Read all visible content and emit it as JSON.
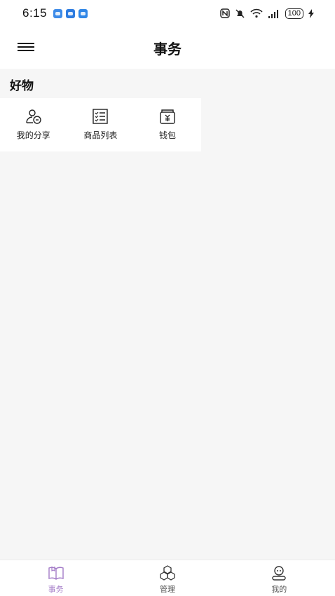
{
  "status_bar": {
    "time": "6:15",
    "battery": "100",
    "app_badge_colors": [
      "#3d8be8",
      "#2c7be0",
      "#2f86e6"
    ]
  },
  "header": {
    "title": "事务",
    "menu_icon": "hamburger-menu-icon"
  },
  "section": {
    "title": "好物",
    "items": [
      {
        "label": "我的分享",
        "icon": "user-share-icon"
      },
      {
        "label": "商品列表",
        "icon": "list-icon"
      },
      {
        "label": "钱包",
        "icon": "wallet-icon"
      }
    ]
  },
  "tabbar": {
    "accent": "#a47cc8",
    "items": [
      {
        "label": "事务",
        "icon": "book-icon",
        "active": true
      },
      {
        "label": "管理",
        "icon": "cubes-icon",
        "active": false
      },
      {
        "label": "我的",
        "icon": "profile-icon",
        "active": false
      }
    ]
  }
}
